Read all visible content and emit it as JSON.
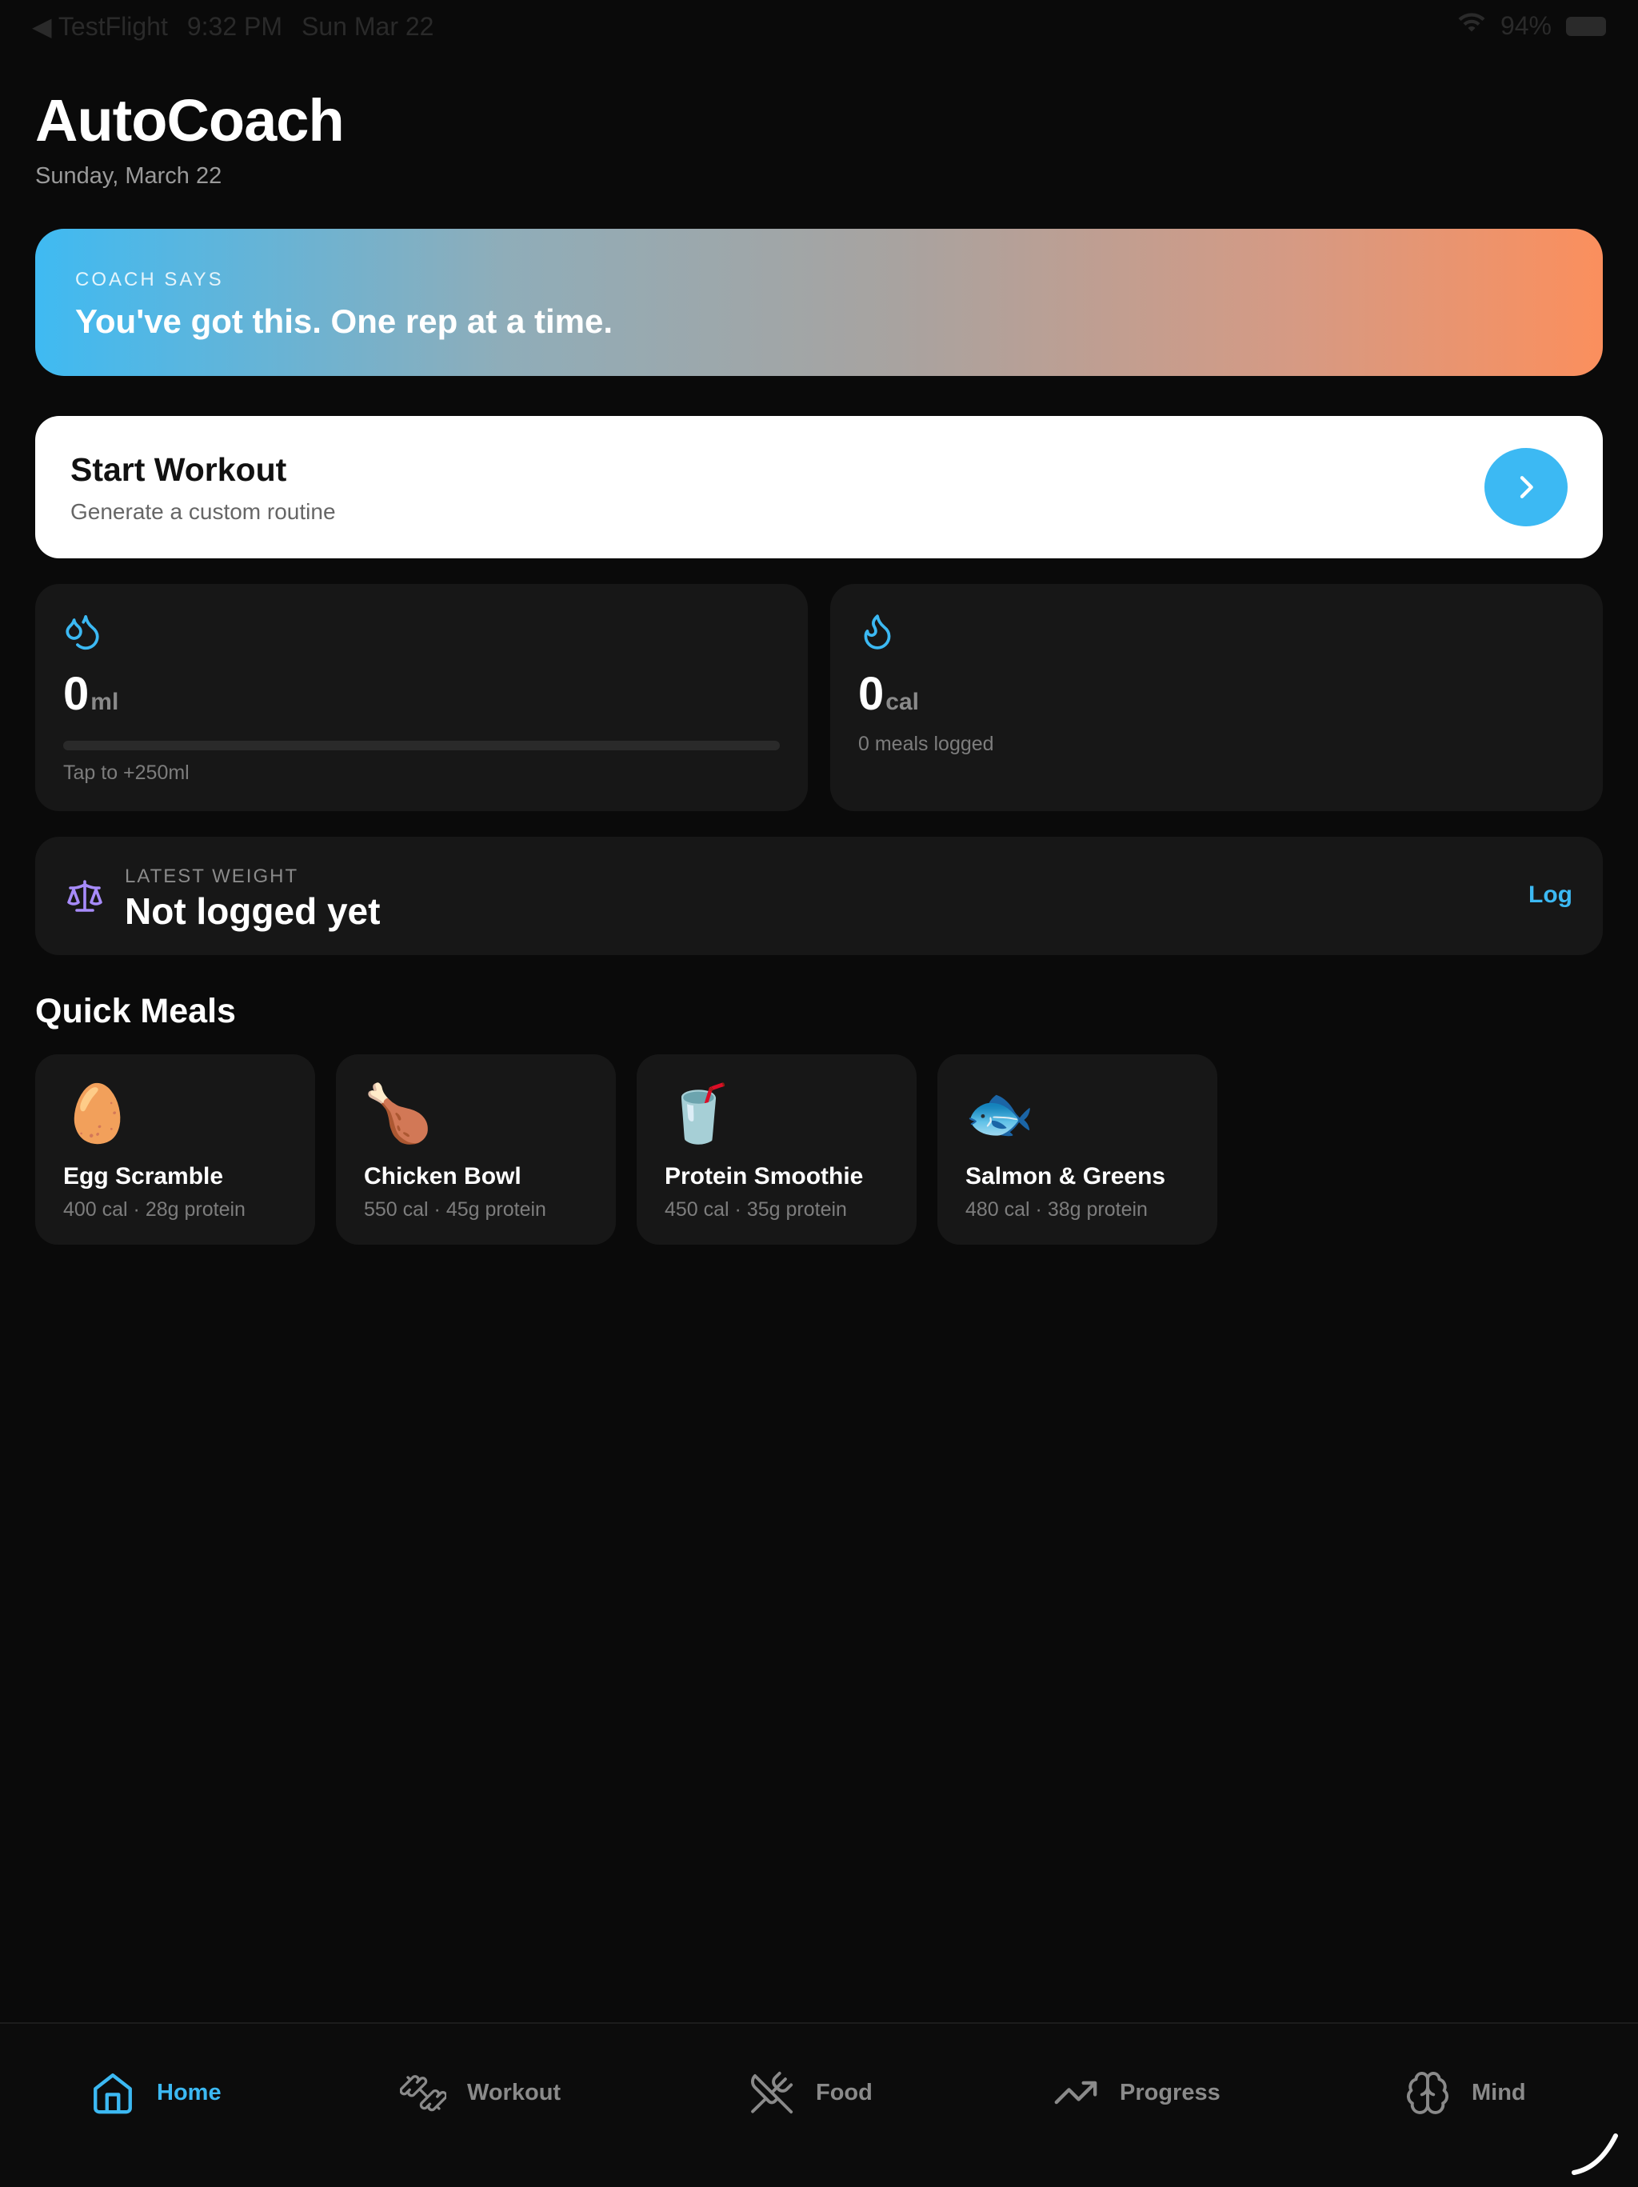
{
  "status_bar": {
    "back_app": "◀ TestFlight",
    "time": "9:32 PM",
    "date": "Sun Mar 22",
    "battery": "94%"
  },
  "header": {
    "title": "AutoCoach",
    "date": "Sunday, March 22"
  },
  "coach": {
    "kicker": "COACH SAYS",
    "quote": "You've got this. One rep at a time."
  },
  "start_workout": {
    "title": "Start Workout",
    "subtitle": "Generate a custom routine"
  },
  "water": {
    "value": "0",
    "unit": "ml",
    "progress": 0,
    "hint": "Tap to +250ml"
  },
  "calories": {
    "value": "0",
    "unit": "cal",
    "meals_logged": "0 meals logged"
  },
  "weight": {
    "kicker": "LATEST WEIGHT",
    "value": "Not logged yet",
    "action": "Log"
  },
  "quick_meals": {
    "title": "Quick Meals",
    "items": [
      {
        "emoji": "🥚",
        "name": "Egg Scramble",
        "info": "400 cal · 28g protein"
      },
      {
        "emoji": "🍗",
        "name": "Chicken Bowl",
        "info": "550 cal · 45g protein"
      },
      {
        "emoji": "🥤",
        "name": "Protein Smoothie",
        "info": "450 cal · 35g protein"
      },
      {
        "emoji": "🐟",
        "name": "Salmon & Greens",
        "info": "480 cal · 38g protein"
      }
    ]
  },
  "tabs": [
    {
      "label": "Home",
      "icon": "home-icon",
      "active": true
    },
    {
      "label": "Workout",
      "icon": "dumbbell-icon",
      "active": false
    },
    {
      "label": "Food",
      "icon": "utensils-icon",
      "active": false
    },
    {
      "label": "Progress",
      "icon": "trending-up-icon",
      "active": false
    },
    {
      "label": "Mind",
      "icon": "brain-icon",
      "active": false
    }
  ],
  "colors": {
    "accent": "#3cb9f3",
    "background": "#0a0a0a",
    "card": "#171717",
    "weight_icon": "#a78bfa"
  }
}
